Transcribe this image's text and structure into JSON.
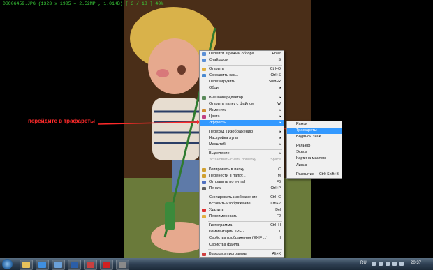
{
  "status_bar": "DSC06459.JPG  (1323 x 1905 = 2.52MP  , 1.01KB)  [ 3 / 18 ]  40%",
  "annotation": "перейдите в трафареты",
  "menu": {
    "items": [
      {
        "label": "Перейти в режим обзора",
        "shortcut": "Enter"
      },
      {
        "label": "Слайдшоу",
        "shortcut": "S"
      },
      {
        "sep": true
      },
      {
        "label": "Открыть",
        "shortcut": "Ctrl+O"
      },
      {
        "label": "Сохранить как...",
        "shortcut": "Ctrl+S"
      },
      {
        "label": "Перезагрузить",
        "shortcut": "Shift+R"
      },
      {
        "label": "Обои",
        "arrow": "▸"
      },
      {
        "sep": true
      },
      {
        "label": "Внешний редактор",
        "arrow": "▸"
      },
      {
        "label": "Открыть папку с файлом",
        "shortcut": "W"
      },
      {
        "label": "Изменить",
        "arrow": "▸"
      },
      {
        "label": "Цвета",
        "arrow": "▸"
      },
      {
        "label": "Эффекты",
        "arrow": "▸",
        "highlight": true
      },
      {
        "sep": true
      },
      {
        "label": "Переход к изображению",
        "arrow": "▸"
      },
      {
        "label": "Настройка лупы",
        "arrow": "▸"
      },
      {
        "label": "Масштаб",
        "arrow": "▸"
      },
      {
        "sep": true
      },
      {
        "label": "Выделение",
        "arrow": "▸"
      },
      {
        "label": "Установить/снять пометку",
        "shortcut": "Space",
        "disabled": true
      },
      {
        "sep": true
      },
      {
        "label": "Копировать в папку...",
        "shortcut": "C"
      },
      {
        "label": "Перенести в папку...",
        "shortcut": "M"
      },
      {
        "label": "Отправить по e-mail",
        "shortcut": "F6"
      },
      {
        "label": "Печать",
        "shortcut": "Ctrl+P"
      },
      {
        "sep": true
      },
      {
        "label": "Скопировать изображение",
        "shortcut": "Ctrl+C"
      },
      {
        "label": "Вставить изображение",
        "shortcut": "Ctrl+V"
      },
      {
        "label": "Удалить",
        "shortcut": "Del"
      },
      {
        "label": "Переименовать",
        "shortcut": "F2"
      },
      {
        "sep": true
      },
      {
        "label": "Гистограмма",
        "shortcut": "Ctrl+H"
      },
      {
        "label": "Комментарий JPEG",
        "shortcut": "T"
      },
      {
        "label": "Свойства изображения (EXIF ...)",
        "shortcut": "I"
      },
      {
        "label": "Свойства файла"
      },
      {
        "sep": true
      },
      {
        "label": "Выход из программы",
        "shortcut": "Alt+X"
      }
    ]
  },
  "submenu": {
    "items": [
      {
        "label": "Рамки"
      },
      {
        "label": "Трафареты",
        "highlight": true
      },
      {
        "label": "Водяной знак"
      },
      {
        "sep": true
      },
      {
        "label": "Рельеф"
      },
      {
        "label": "Эскиз"
      },
      {
        "label": "Картина маслом"
      },
      {
        "label": "Линза"
      },
      {
        "sep": true
      },
      {
        "label": "Размытие",
        "shortcut": "Ctrl+Shift+B"
      }
    ]
  },
  "taskbar": {
    "lang": "RU",
    "time": "20:37",
    "apps": [
      {
        "icon": "folder-icon",
        "color": "#e8c25a"
      },
      {
        "icon": "ie-icon",
        "color": "#3f8fe0"
      },
      {
        "icon": "media-icon",
        "color": "#6aa0d8"
      },
      {
        "icon": "photoshop-icon",
        "color": "#2b5ea8"
      },
      {
        "icon": "viewer-icon",
        "color": "#c84040"
      },
      {
        "icon": "opera-icon",
        "color": "#d02020"
      },
      {
        "icon": "app-icon",
        "color": "#8a8a8a"
      }
    ]
  },
  "colors": {
    "highlight": "#3399ff",
    "annotation": "#ff2a2a",
    "status": "#3cd63c"
  }
}
